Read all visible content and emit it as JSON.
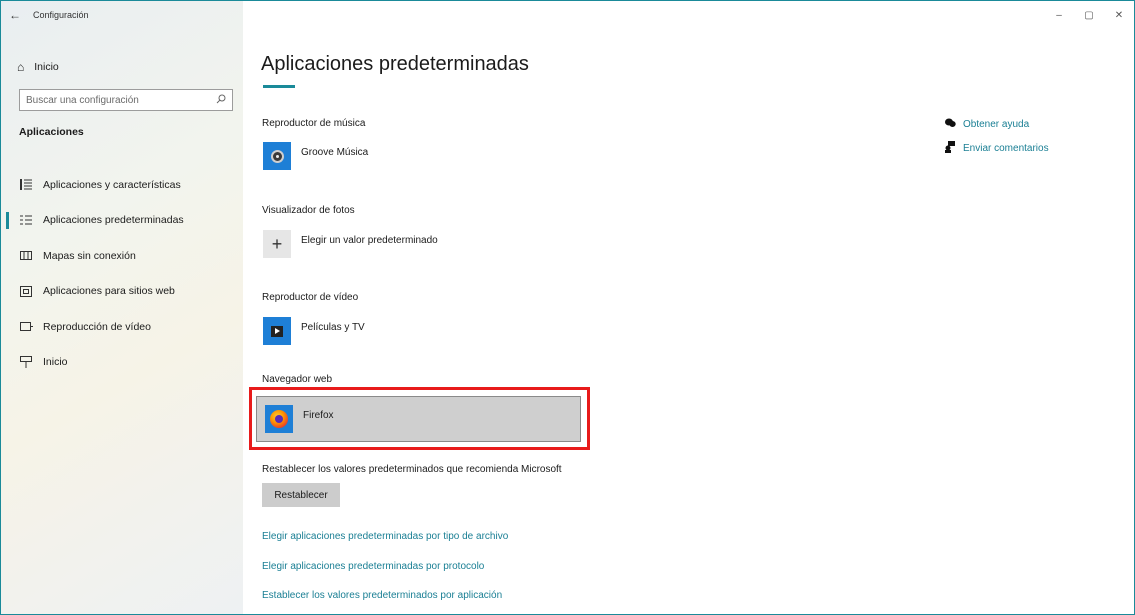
{
  "window": {
    "app_title": "Configuración",
    "back_icon": "back-arrow-icon",
    "controls": {
      "minimize": "–",
      "maximize": "▢",
      "close": "✕"
    }
  },
  "sidebar": {
    "home_label": "Inicio",
    "search_placeholder": "Buscar una configuración",
    "section_title": "Aplicaciones",
    "items": [
      {
        "label": "Aplicaciones y características",
        "icon": "apps-list-icon",
        "active": false
      },
      {
        "label": "Aplicaciones predeterminadas",
        "icon": "default-apps-icon",
        "active": true
      },
      {
        "label": "Mapas sin conexión",
        "icon": "offline-maps-icon",
        "active": false
      },
      {
        "label": "Aplicaciones para sitios web",
        "icon": "apps-websites-icon",
        "active": false
      },
      {
        "label": "Reproducción de vídeo",
        "icon": "video-playback-icon",
        "active": false
      },
      {
        "label": "Inicio",
        "icon": "startup-icon",
        "active": false
      }
    ]
  },
  "main": {
    "title": "Aplicaciones predeterminadas",
    "groups": [
      {
        "label": "Reproductor de música",
        "app": "Groove Música",
        "icon": "groove-music-icon"
      },
      {
        "label": "Visualizador de fotos",
        "app": "Elegir un valor predeterminado",
        "icon": "plus-icon"
      },
      {
        "label": "Reproductor de vídeo",
        "app": "Películas y TV",
        "icon": "movies-tv-icon"
      },
      {
        "label": "Navegador web",
        "app": "Firefox",
        "icon": "firefox-icon"
      }
    ],
    "reset_text": "Restablecer los valores predeterminados que recomienda Microsoft",
    "reset_button": "Restablecer",
    "links": [
      "Elegir aplicaciones predeterminadas por tipo de archivo",
      "Elegir aplicaciones predeterminadas por protocolo",
      "Establecer los valores predeterminados por aplicación"
    ]
  },
  "help": {
    "get_help": "Obtener ayuda",
    "feedback": "Enviar comentarios"
  },
  "colors": {
    "accent": "#1a8a99",
    "link": "#1a7f94",
    "highlight": "#e81b1b",
    "app_tile": "#1e7fd6"
  }
}
